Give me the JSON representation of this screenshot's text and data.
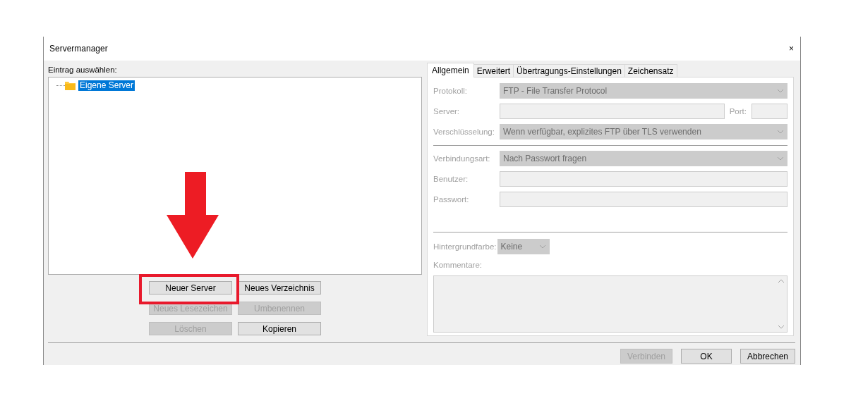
{
  "window": {
    "title": "Servermanager",
    "close_icon": "×"
  },
  "entry_label": "Eintrag auswählen:",
  "tree": [
    {
      "label": "Eigene Server",
      "selected": true
    }
  ],
  "tree_buttons": [
    {
      "label": "Neuer Server",
      "disabled": false,
      "highlighted": true
    },
    {
      "label": "Neues Verzeichnis",
      "disabled": false,
      "highlighted": false
    },
    {
      "label": "Neues Lesezeichen",
      "disabled": true,
      "highlighted": false
    },
    {
      "label": "Umbenennen",
      "disabled": true,
      "highlighted": false
    },
    {
      "label": "Löschen",
      "disabled": true,
      "highlighted": false
    },
    {
      "label": "Kopieren",
      "disabled": false,
      "highlighted": false
    }
  ],
  "annotations": [
    {
      "kind": "arrow"
    }
  ],
  "tabs": [
    {
      "label": "Allgemein",
      "selected": true
    },
    {
      "label": "Erweitert",
      "selected": false
    },
    {
      "label": "Übertragungs-Einstellungen",
      "selected": false
    },
    {
      "label": "Zeichensatz",
      "selected": false
    }
  ],
  "form": [
    {
      "kind": "select",
      "label": "Protokoll:",
      "value": "FTP - File Transfer Protocol",
      "disabled": true
    },
    {
      "kind": "server",
      "label": "Server:",
      "port_label": "Port:",
      "disabled": true
    },
    {
      "kind": "select",
      "label": "Verschlüsselung:",
      "value": "Wenn verfügbar, explizites FTP über TLS verwenden",
      "disabled": true
    },
    {
      "kind": "divider"
    },
    {
      "kind": "select",
      "label": "Verbindungsart:",
      "value": "Nach Passwort fragen",
      "disabled": true
    },
    {
      "kind": "text",
      "label": "Benutzer:",
      "disabled": true
    },
    {
      "kind": "text",
      "label": "Passwort:",
      "disabled": true
    }
  ],
  "background_color": {
    "label": "Hintergrundfarbe:",
    "value": "Keine",
    "disabled": true
  },
  "comments": {
    "label": "Kommentare:",
    "disabled": true
  },
  "footer_buttons": [
    {
      "label": "Verbinden",
      "disabled": true
    },
    {
      "label": "OK",
      "disabled": false
    },
    {
      "label": "Abbrechen",
      "disabled": false
    }
  ]
}
